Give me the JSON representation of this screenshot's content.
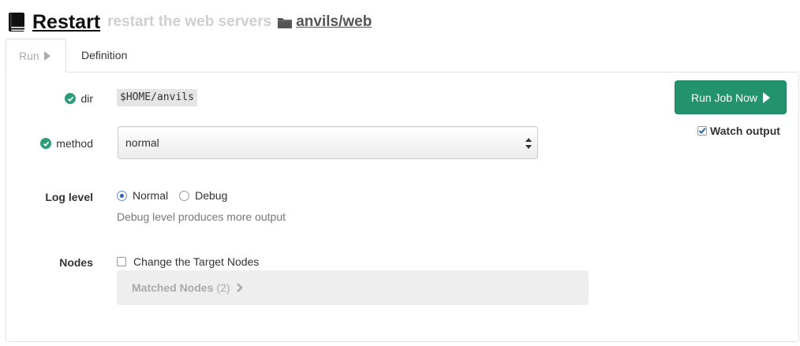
{
  "header": {
    "title": "Restart",
    "description": "restart the web servers",
    "group": "anvils/web",
    "icons": {
      "job": "book-icon",
      "group": "folder-icon"
    }
  },
  "tabs": [
    {
      "label": "Run",
      "active": true
    },
    {
      "label": "Definition",
      "active": false
    }
  ],
  "options": {
    "dir": {
      "label": "dir",
      "value": "$HOME/anvils",
      "valid": true
    },
    "method": {
      "label": "method",
      "selected": "normal",
      "valid": true
    }
  },
  "run_button": {
    "label": "Run Job Now"
  },
  "watch_output": {
    "label": "Watch output",
    "checked": true
  },
  "log_level": {
    "label": "Log level",
    "options": [
      {
        "label": "Normal",
        "checked": true
      },
      {
        "label": "Debug",
        "checked": false
      }
    ],
    "help": "Debug level produces more output"
  },
  "nodes": {
    "label": "Nodes",
    "change_target_label": "Change the Target Nodes",
    "change_target_checked": false,
    "matched_label": "Matched Nodes",
    "matched_count": "(2)"
  },
  "colors": {
    "primary": "#23936e",
    "valid_badge": "#2a9d7a",
    "muted": "#aaaaaa"
  }
}
